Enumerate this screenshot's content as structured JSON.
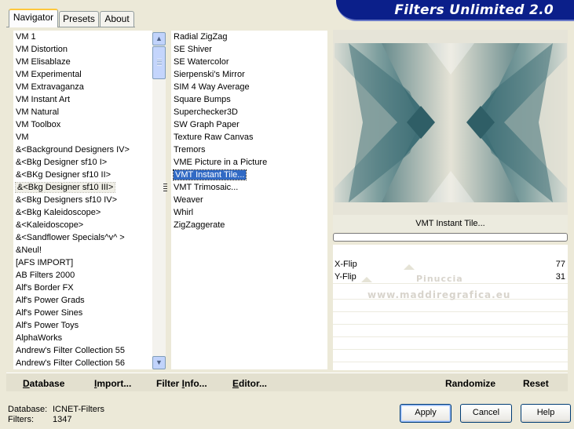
{
  "tabs": [
    {
      "label": "Navigator",
      "active": true
    },
    {
      "label": "Presets",
      "active": false
    },
    {
      "label": "About",
      "active": false
    }
  ],
  "app_title": "Filters Unlimited 2.0",
  "categories": [
    "VM 1",
    "VM Distortion",
    "VM Elisablaze",
    "VM Experimental",
    "VM Extravaganza",
    "VM Instant Art",
    "VM Natural",
    "VM Toolbox",
    "VM",
    "&<Background Designers IV>",
    "&<Bkg Designer sf10 I>",
    "&<BKg Designer sf10 II>",
    "&<Bkg Designer sf10 III>",
    "&<Bkg Designers sf10 IV>",
    "&<Bkg Kaleidoscope>",
    "&<Kaleidoscope>",
    "&<Sandflower Specials^v^ >",
    "&Neul!",
    "[AFS IMPORT]",
    "AB Filters 2000",
    "Alf's Border FX",
    "Alf's Power Grads",
    "Alf's Power Sines",
    "Alf's Power Toys",
    "AlphaWorks",
    "Andrew's Filter Collection 55",
    "Andrew's Filter Collection 56"
  ],
  "selected_category": "&<Bkg Designer sf10 III>",
  "filters": [
    "Radial ZigZag",
    "SE Shiver",
    "SE Watercolor",
    "Sierpenski's Mirror",
    "SIM 4 Way Average",
    "Square Bumps",
    "Superchecker3D",
    "SW Graph Paper",
    "Texture Raw Canvas",
    "Tremors",
    "VME Picture in a Picture",
    "VMT Instant Tile...",
    "VMT Trimosaic...",
    "Weaver",
    "Whirl",
    "ZigZaggerate"
  ],
  "selected_filter": "VMT Instant Tile...",
  "preview": {
    "filter_name": "VMT Instant Tile...",
    "colors": {
      "dark": "#3f6f77",
      "mid": "#8fb0b0",
      "light": "#e5e3d6"
    }
  },
  "params": [
    {
      "label": "X-Flip",
      "value": "77",
      "level": 77
    },
    {
      "label": "Y-Flip",
      "value": "31",
      "level": 31
    }
  ],
  "watermark": {
    "line1": "Pinuccia",
    "line2": "www.maddiregrafica.eu"
  },
  "links": {
    "database": {
      "u": "D",
      "rest": "atabase"
    },
    "import": {
      "u": "I",
      "rest": "mport..."
    },
    "filter_info": {
      "pre": "Filter ",
      "u": "I",
      "rest": "nfo..."
    },
    "editor": {
      "u": "E",
      "rest": "ditor..."
    },
    "randomize": "Randomize",
    "reset": "Reset"
  },
  "status": {
    "database_label": "Database:",
    "database_value": "ICNET-Filters",
    "filters_label": "Filters:",
    "filters_value": "1347"
  },
  "buttons": {
    "apply": "Apply",
    "cancel": "Cancel",
    "help": "Help"
  }
}
